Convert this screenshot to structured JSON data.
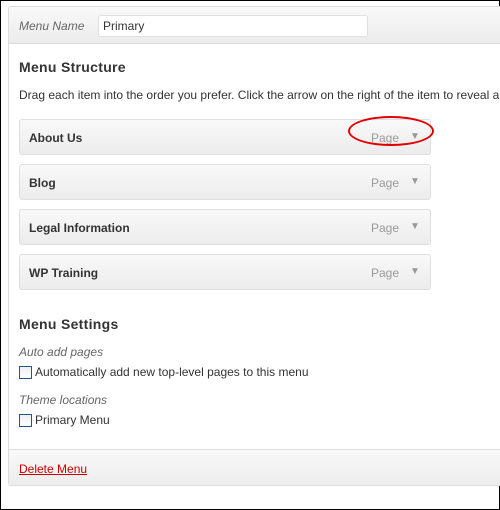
{
  "menu_name": {
    "label": "Menu Name",
    "value": "Primary"
  },
  "structure": {
    "title": "Menu Structure",
    "description": "Drag each item into the order you prefer. Click the arrow on the right of the item to reveal a",
    "items": [
      {
        "title": "About Us",
        "type": "Page"
      },
      {
        "title": "Blog",
        "type": "Page"
      },
      {
        "title": "Legal Information",
        "type": "Page"
      },
      {
        "title": "WP Training",
        "type": "Page"
      }
    ]
  },
  "settings": {
    "title": "Menu Settings",
    "auto_add_label": "Auto add pages",
    "auto_add_option": "Automatically add new top-level pages to this menu",
    "theme_locations_label": "Theme locations",
    "primary_menu_option": "Primary Menu"
  },
  "footer": {
    "delete_label": "Delete Menu"
  },
  "icons": {
    "item_toggle": "triangle-down-icon"
  },
  "colors": {
    "delete_link": "#cc0000",
    "annotation_circle": "#e00000"
  }
}
